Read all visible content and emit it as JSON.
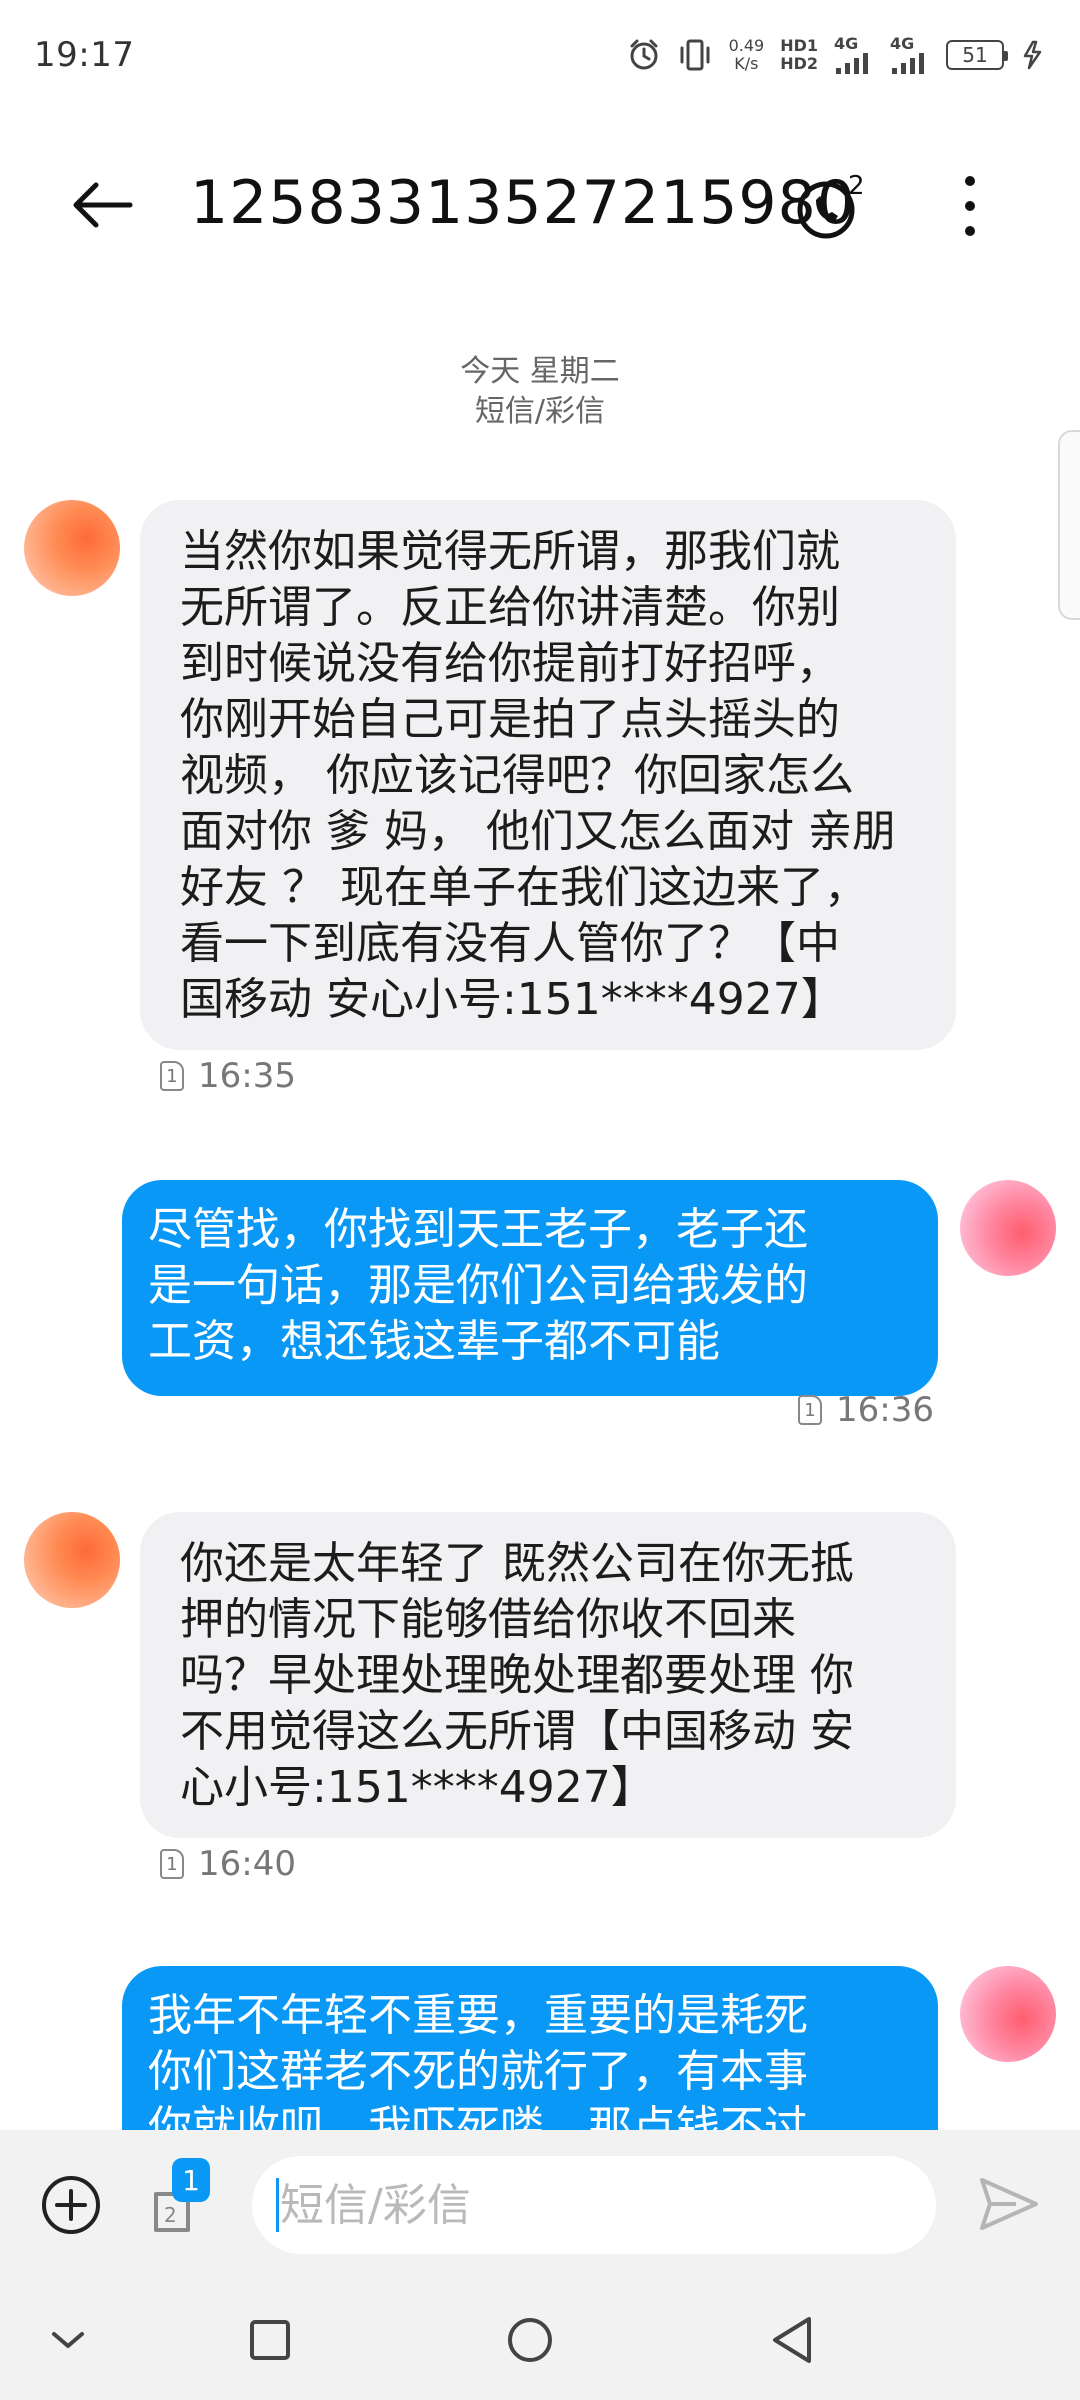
{
  "status_bar": {
    "time": "19:17",
    "net_speed_value": "0.49",
    "net_speed_unit": "K/s",
    "hd1": "HD1",
    "hd2": "HD2",
    "sig1": "4G",
    "sig2": "4G",
    "battery": "51",
    "icons": [
      "alarm-icon",
      "vibrate-icon",
      "signal-icon",
      "charging-icon"
    ]
  },
  "header": {
    "title": "1258331352721598​0",
    "call_badge": "2",
    "icons": [
      "back-arrow-icon",
      "phone-call-icon",
      "more-vert-icon"
    ]
  },
  "date_separator": {
    "date": "今天 星期二",
    "channel": "短信/彩信"
  },
  "messages": [
    {
      "direction": "in",
      "text": "当然你如果觉得无所谓，那我们就\n无所谓了。反正给你讲清楚。你别\n到时候说没有给你提前打好招呼，\n你刚开始自己可是拍了点头摇头的\n视频， 你应该记得吧？你回家怎么\n面对你 爹 妈， 他们又怎么面对 亲朋\n好友 ？ 现在单子在我们这边来了，\n看一下到底有没有人管你了？【中\n国移动 安心小号:151****4927】",
      "sim": "1",
      "time": "16:35"
    },
    {
      "direction": "out",
      "text": "尽管找，你找到天王老子，老子还\n是一句话，那是你们公司给我发的\n工资，想还钱这辈子都不可能",
      "sim": "1",
      "time": "16:36"
    },
    {
      "direction": "in",
      "text": "你还是太年轻了 既然公司在你无抵\n押的情况下能够借给你收不回来\n吗？早处理处理晚处理都要处理 你\n不用觉得这么无所谓【中国移动 安\n心小号:151****4927】",
      "sim": "1",
      "time": "16:40"
    },
    {
      "direction": "out",
      "text": "我年不年轻不重要，重要的是耗死\n你们这群老不死的就行了，有本事\n你就收呗，我吓死喽，那点钱不过",
      "sim": "",
      "time": ""
    }
  ],
  "composer": {
    "placeholder": "短信/彩信",
    "sim_badge": "1",
    "icons": [
      "add-circle-icon",
      "sim-switch-icon",
      "send-icon"
    ]
  },
  "nav_bar": {
    "icons": [
      "nav-down-icon",
      "nav-recents-icon",
      "nav-home-icon",
      "nav-back-icon"
    ]
  },
  "colors": {
    "outgoing_bubble": "#0a98f6",
    "incoming_bubble": "#f1f1f3",
    "background": "#ffffff",
    "composer_bg": "#f2f2f2"
  }
}
